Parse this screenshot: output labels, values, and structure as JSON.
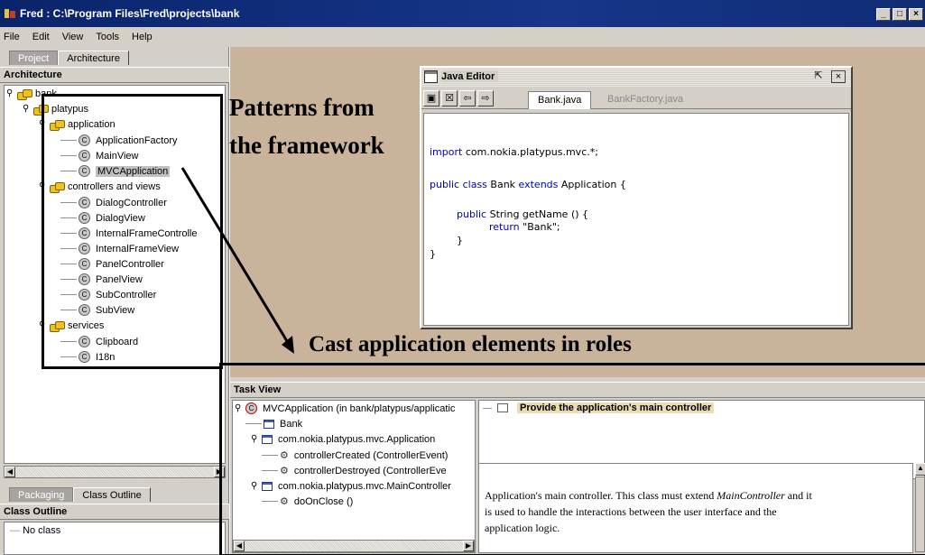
{
  "window": {
    "title": "Fred : C:\\Program Files\\Fred\\projects\\bank",
    "min": "_",
    "max": "□",
    "close": "×"
  },
  "menu": [
    "File",
    "Edit",
    "View",
    "Tools",
    "Help"
  ],
  "left": {
    "tabs": [
      "Project",
      "Architecture"
    ],
    "header": "Architecture",
    "tree": {
      "root": "bank",
      "platypus": "platypus",
      "application": "application",
      "application_items": [
        "ApplicationFactory",
        "MainView",
        "MVCApplication"
      ],
      "controllers": "controllers and views",
      "controller_items": [
        "DialogController",
        "DialogView",
        "InternalFrameControlle",
        "InternalFrameView",
        "PanelController",
        "PanelView",
        "SubController",
        "SubView"
      ],
      "services": "services",
      "service_items": [
        "Clipboard",
        "I18n"
      ]
    },
    "outline_tabs": [
      "Packaging",
      "Class Outline"
    ],
    "outline_header": "Class Outline",
    "outline_value": "No class"
  },
  "editor": {
    "title": "Java Editor",
    "tabs": [
      "Bank.java",
      "BankFactory.java"
    ],
    "code": {
      "l1a": "import",
      "l1b": " com.nokia.platypus.mvc.*;",
      "l2a": "public class",
      "l2b": " Bank ",
      "l2c": "extends",
      "l2d": " Application {",
      "l3a": "public",
      "l3b": " String getName () {",
      "l4a": "return",
      "l4b": " \"Bank\";",
      "l5": "}",
      "l6": "}"
    }
  },
  "annotations": {
    "patterns_1": "Patterns from",
    "patterns_2": "the framework",
    "cast": "Cast application elements in roles"
  },
  "taskview": {
    "header": "Task View",
    "root": "MVCApplication (in bank/platypus/applicatic",
    "items": {
      "bank": "Bank",
      "application": "com.nokia.platypus.mvc.Application",
      "created": "controllerCreated (ControllerEvent)",
      "destroyed": "controllerDestroyed (ControllerEve",
      "main_controller": "com.nokia.platypus.mvc.MainController",
      "onclose": "doOnClose ()"
    },
    "task": "Provide the application's main controller",
    "description_1a": "Application's main controller. This class must extend ",
    "description_1b": "MainController",
    "description_1c": " and it",
    "description_2": "is used to handle the interactions between the user interface and the",
    "description_3": "application logic."
  }
}
